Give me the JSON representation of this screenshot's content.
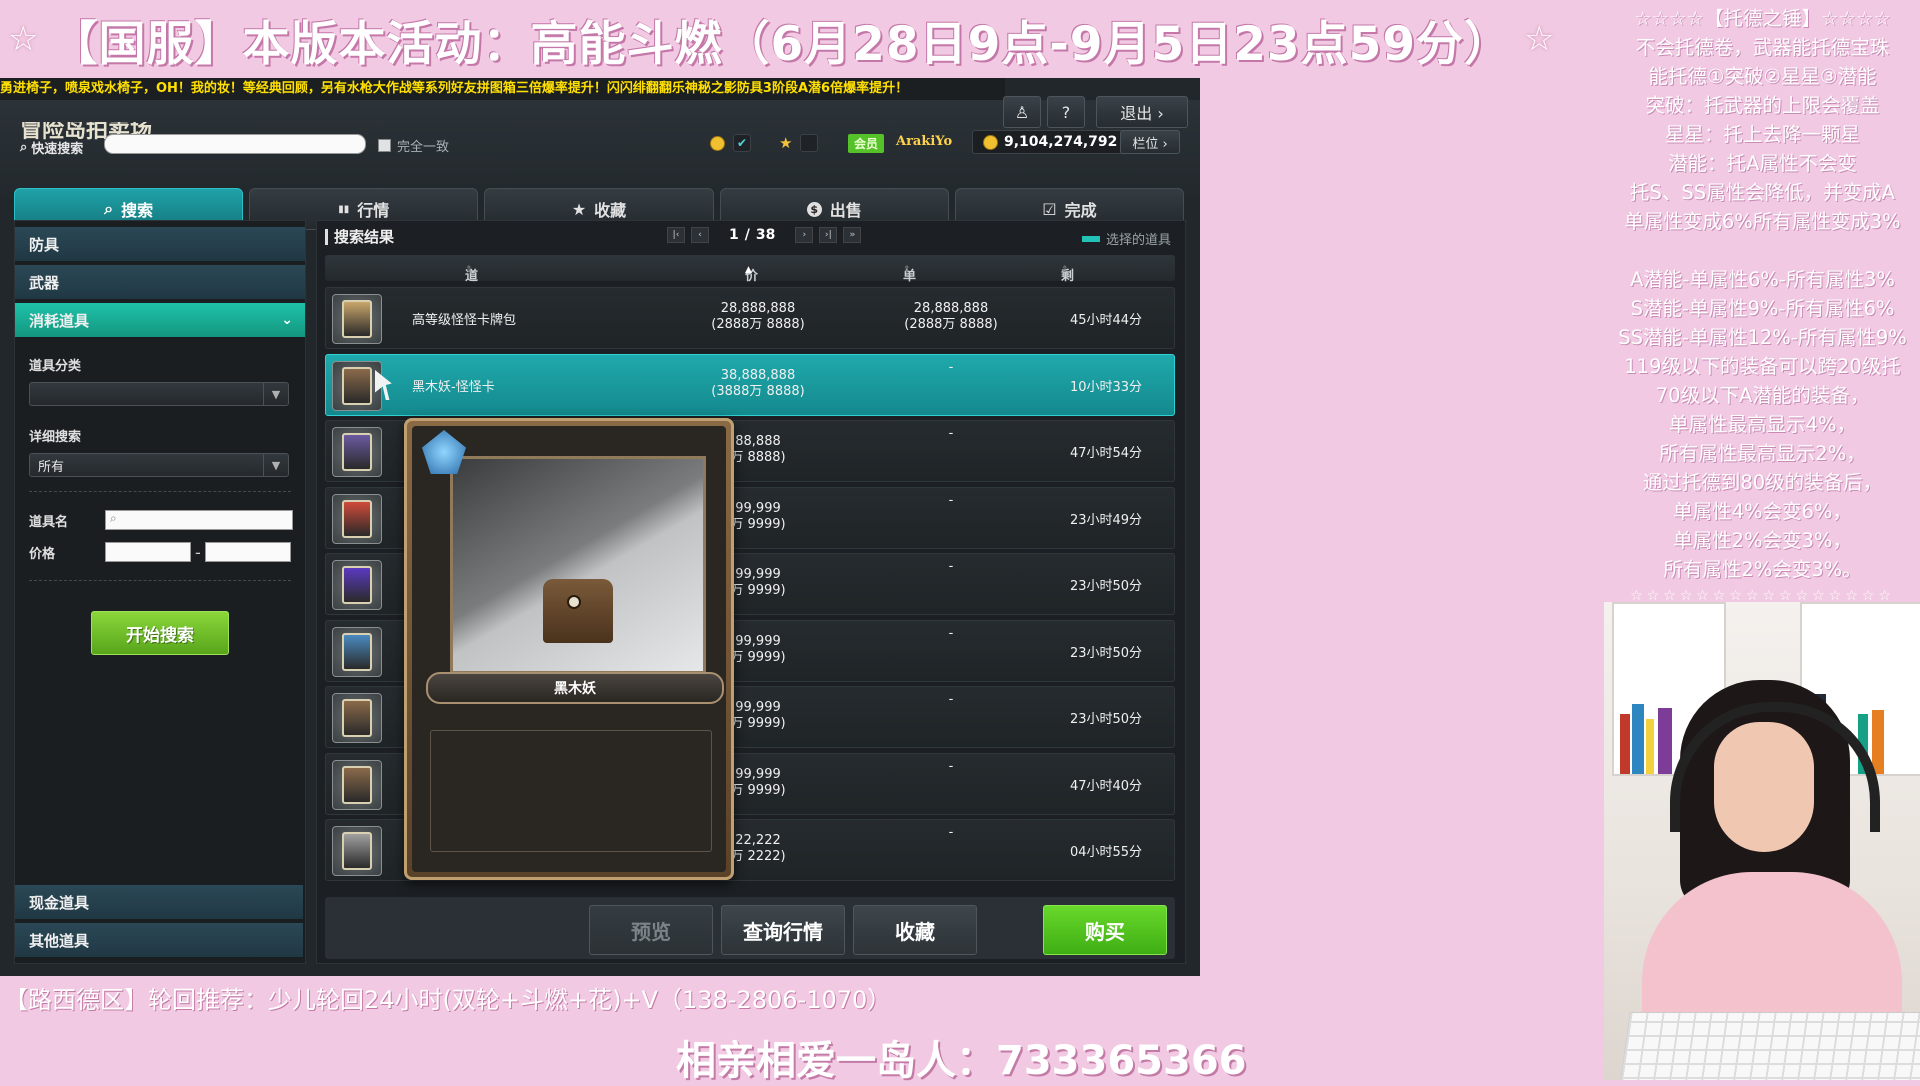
{
  "overlay": {
    "banner_title": "【国服】本版本活动：高能斗燃（6月28日9点-9月5日23点59分）",
    "star_glyph": "☆",
    "right_notes": [
      "☆☆☆☆【托德之锤】☆☆☆☆",
      "不会托德卷，武器能托德宝珠",
      "能托德①突破②星星③潜能",
      "突破：托武器的上限会覆盖",
      "星星：托上去降一颗星",
      "潜能：托A属性不会变",
      "托S、SS属性会降低，并变成A",
      "单属性变成6%所有属性变成3%",
      "",
      "A潜能-单属性6%-所有属性3%",
      "S潜能-单属性9%-所有属性6%",
      "SS潜能-单属性12%-所有属性9%",
      "119级以下的装备可以跨20级托",
      "70级以下A潜能的装备，",
      "单属性最高显示4%，",
      "所有属性最高显示2%，",
      "通过托德到80级的装备后，",
      "单属性4%会变6%，",
      "单属性2%会变3%，",
      "所有属性2%会变3%。"
    ],
    "stars_row": "☆☆☆☆☆☆☆☆☆☆☆☆☆☆☆☆",
    "bottom_line1": "【路西德区】轮回推荐：少儿轮回24小时(双轮+斗燃+花)+V（138-2806-1070）",
    "bottom_line2": "相亲相爱一岛人：733365366"
  },
  "game": {
    "ticker": "勇进椅子，喷泉戏水椅子，OH！我的妆！等经典回顾，另有水枪大作战等系列好友拼图箱三倍爆率提升！闪闪绯翻翻乐神秘之影防具3阶段A潜6倍爆率提升！",
    "window_title": "冒险岛拍卖场",
    "header_buttons": {
      "user_icon": "♙",
      "help": "?",
      "exit": "退出 ›"
    },
    "quick_search_label": "快速搜索",
    "quick_search_value": "",
    "exact_match_label": "完全一致",
    "member_label": "会员",
    "username": "ArakiYo",
    "meso": "9,104,274,792",
    "slot_button": "栏位 ›",
    "tabs": [
      {
        "icon": "🔍",
        "label": "搜索"
      },
      {
        "icon": "▮▮",
        "label": "行情"
      },
      {
        "icon": "★",
        "label": "收藏"
      },
      {
        "icon": "$",
        "label": "出售"
      },
      {
        "icon": "☑",
        "label": "完成"
      }
    ],
    "sidebar": {
      "categories": [
        "防具",
        "武器",
        "消耗道具"
      ],
      "active_chevron": "⌄",
      "item_class_label": "道具分类",
      "item_class_value": "",
      "detail_search_label": "详细搜索",
      "detail_search_value": "所有",
      "item_name_label": "道具名",
      "price_label": "价格",
      "price_sep": "-",
      "start_button": "开始搜索",
      "bottom_categories": [
        "现金道具",
        "其他道具"
      ]
    },
    "results": {
      "title": "搜索结果",
      "page_current": "1",
      "page_sep": "/",
      "page_total": "38",
      "legend": "选择的道具",
      "columns": [
        "道具名称",
        "价格",
        "单个价格",
        "剩余时间"
      ],
      "rows": [
        {
          "name": "高等级怪怪卡牌包",
          "price1": "28,888,888",
          "price2": "(2888万 8888)",
          "unit1": "28,888,888",
          "unit2": "(2888万 8888)",
          "unit_dash": "",
          "remain": "45小时44分",
          "color": "#c9a66b"
        },
        {
          "name": "黑木妖-怪怪卡",
          "price1": "38,888,888",
          "price2": "(3888万 8888)",
          "unit1": "",
          "unit2": "",
          "unit_dash": "-",
          "remain": "10小时33分",
          "color": "#8a6a4a"
        },
        {
          "name": "",
          "price1": "88,888",
          "price2": "万 8888)",
          "unit1": "",
          "unit2": "",
          "unit_dash": "-",
          "remain": "47小时54分",
          "color": "#6a5aa0"
        },
        {
          "name": "",
          "price1": "99,999",
          "price2": "万 9999)",
          "unit1": "",
          "unit2": "",
          "unit_dash": "-",
          "remain": "23小时49分",
          "color": "#d04a3a"
        },
        {
          "name": "",
          "price1": "99,999",
          "price2": "万 9999)",
          "unit1": "",
          "unit2": "",
          "unit_dash": "-",
          "remain": "23小时50分",
          "color": "#5a3ac0"
        },
        {
          "name": "",
          "price1": "99,999",
          "price2": "万 9999)",
          "unit1": "",
          "unit2": "",
          "unit_dash": "-",
          "remain": "23小时50分",
          "color": "#4a8ac0"
        },
        {
          "name": "",
          "price1": "99,999",
          "price2": "万 9999)",
          "unit1": "",
          "unit2": "",
          "unit_dash": "-",
          "remain": "23小时50分",
          "color": "#8a6a4a"
        },
        {
          "name": "",
          "price1": "99,999",
          "price2": "万 9999)",
          "unit1": "",
          "unit2": "",
          "unit_dash": "-",
          "remain": "47小时40分",
          "color": "#8a6a4a"
        },
        {
          "name": "",
          "price1": "22,222",
          "price2": "万 2222)",
          "unit1": "",
          "unit2": "",
          "unit_dash": "-",
          "remain": "04小时55分",
          "color": "#a0a0a0"
        }
      ]
    },
    "footer_buttons": {
      "preview": "预览",
      "market": "查询行情",
      "favorite": "收藏",
      "buy": "购买"
    },
    "popup": {
      "card_name": "黑木妖"
    }
  }
}
